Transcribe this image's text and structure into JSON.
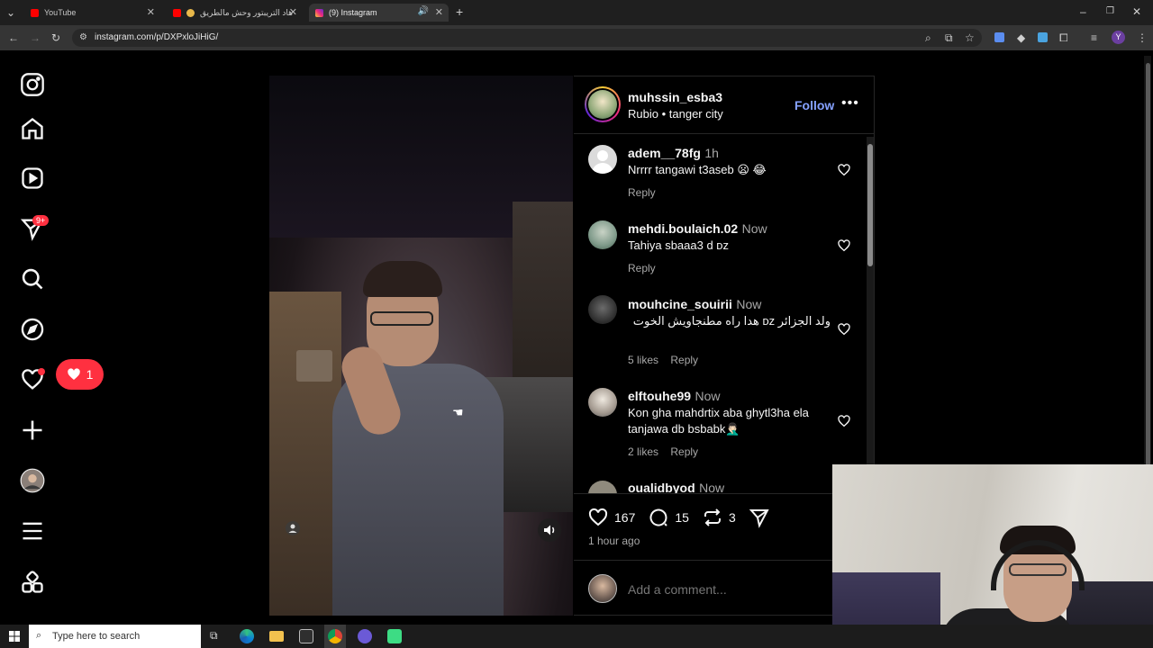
{
  "browser": {
    "tabs": [
      {
        "label": "YouTube",
        "active": false
      },
      {
        "label": "هاد التريبتور وحش مالطريق",
        "active": false
      },
      {
        "label": "(9) Instagram",
        "active": true
      }
    ],
    "url": "instagram.com/p/DXPxloJiHiG/"
  },
  "nav": {
    "notifications_badge": "9+",
    "like_notification_count": "1"
  },
  "post": {
    "author": "muhssin_esba3",
    "audio": "Rubio",
    "location": "tanger city",
    "follow_label": "Follow",
    "likes": "167",
    "comments_count": "15",
    "reposts": "3",
    "posted_ago": "1 hour ago",
    "add_comment_placeholder": "Add a comment..."
  },
  "comments": [
    {
      "user": "adem__78fg",
      "time": "1h",
      "text": "Nrrrr tangawi t3aseb 😦 😂",
      "likes": "",
      "reply": "Reply"
    },
    {
      "user": "mehdi.boulaich.02",
      "time": "Now",
      "text": "Tahiya sbaaa3 d ᴅᴢ",
      "likes": "",
      "reply": "Reply"
    },
    {
      "user": "mouhcine_souirii",
      "time": "Now",
      "text": "ولد الجزائر ᴅᴢ هدا راه مطنجاويش الخوت",
      "likes": "5 likes",
      "reply": "Reply"
    },
    {
      "user": "elftouhe99",
      "time": "Now",
      "text": "Kon gha mahdrtix aba ghytl3ha ela tanjawa db bsbabk🤦🏻‍♂️",
      "likes": "2 likes",
      "reply": "Reply"
    },
    {
      "user": "oualidbyod",
      "time": "Now",
      "text": "",
      "likes": "",
      "reply": ""
    }
  ],
  "taskbar": {
    "search_placeholder": "Type here to search"
  },
  "colors": {
    "follow": "#85a1ff",
    "badge": "#ff3040",
    "background": "#000000"
  }
}
